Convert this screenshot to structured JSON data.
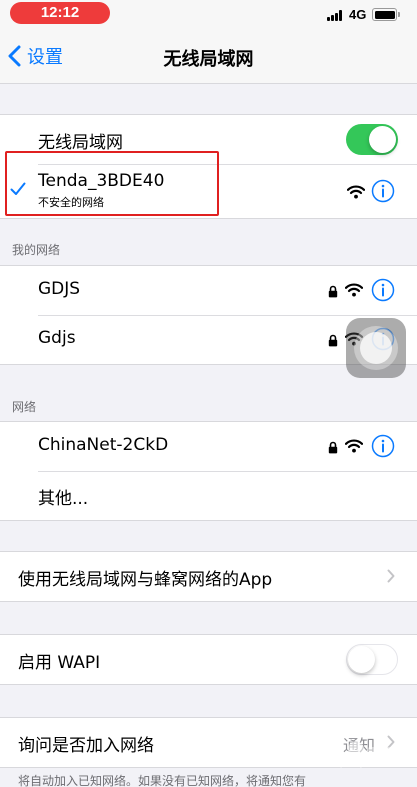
{
  "status_bar": {
    "time": "12:12",
    "network_type": "4G",
    "signal_bars": 4,
    "battery_level": 1.0
  },
  "nav": {
    "back_label": "设置",
    "title": "无线局域网"
  },
  "wifi": {
    "toggle_label": "无线局域网",
    "enabled": true,
    "connected": {
      "name": "Tenda_3BDE40",
      "subtitle": "不安全的网络",
      "secured": false
    }
  },
  "my_networks": {
    "header": "我的网络",
    "items": [
      {
        "name": "GDJS",
        "secured": true
      },
      {
        "name": "Gdjs",
        "secured": true
      }
    ]
  },
  "networks": {
    "header": "网络",
    "items": [
      {
        "name": "ChinaNet-2CkD",
        "secured": true
      }
    ],
    "other_label": "其他..."
  },
  "app_wlan_cellular": {
    "label": "使用无线局域网与蜂窝网络的App"
  },
  "wapi": {
    "label": "启用 WAPI",
    "enabled": false
  },
  "ask_to_join": {
    "label": "询问是否加入网络",
    "value": "通知",
    "footer": "将自动加入已知网络。如果没有已知网络，将通知您有"
  },
  "colors": {
    "accent": "#0a7aff",
    "toggle_on": "#34c759",
    "highlight": "#e02020",
    "status_pill": "#ee3b3b"
  },
  "icons": [
    "chevron-left-icon",
    "checkmark-icon",
    "wifi-icon",
    "lock-icon",
    "info-icon",
    "chevron-right-icon"
  ]
}
